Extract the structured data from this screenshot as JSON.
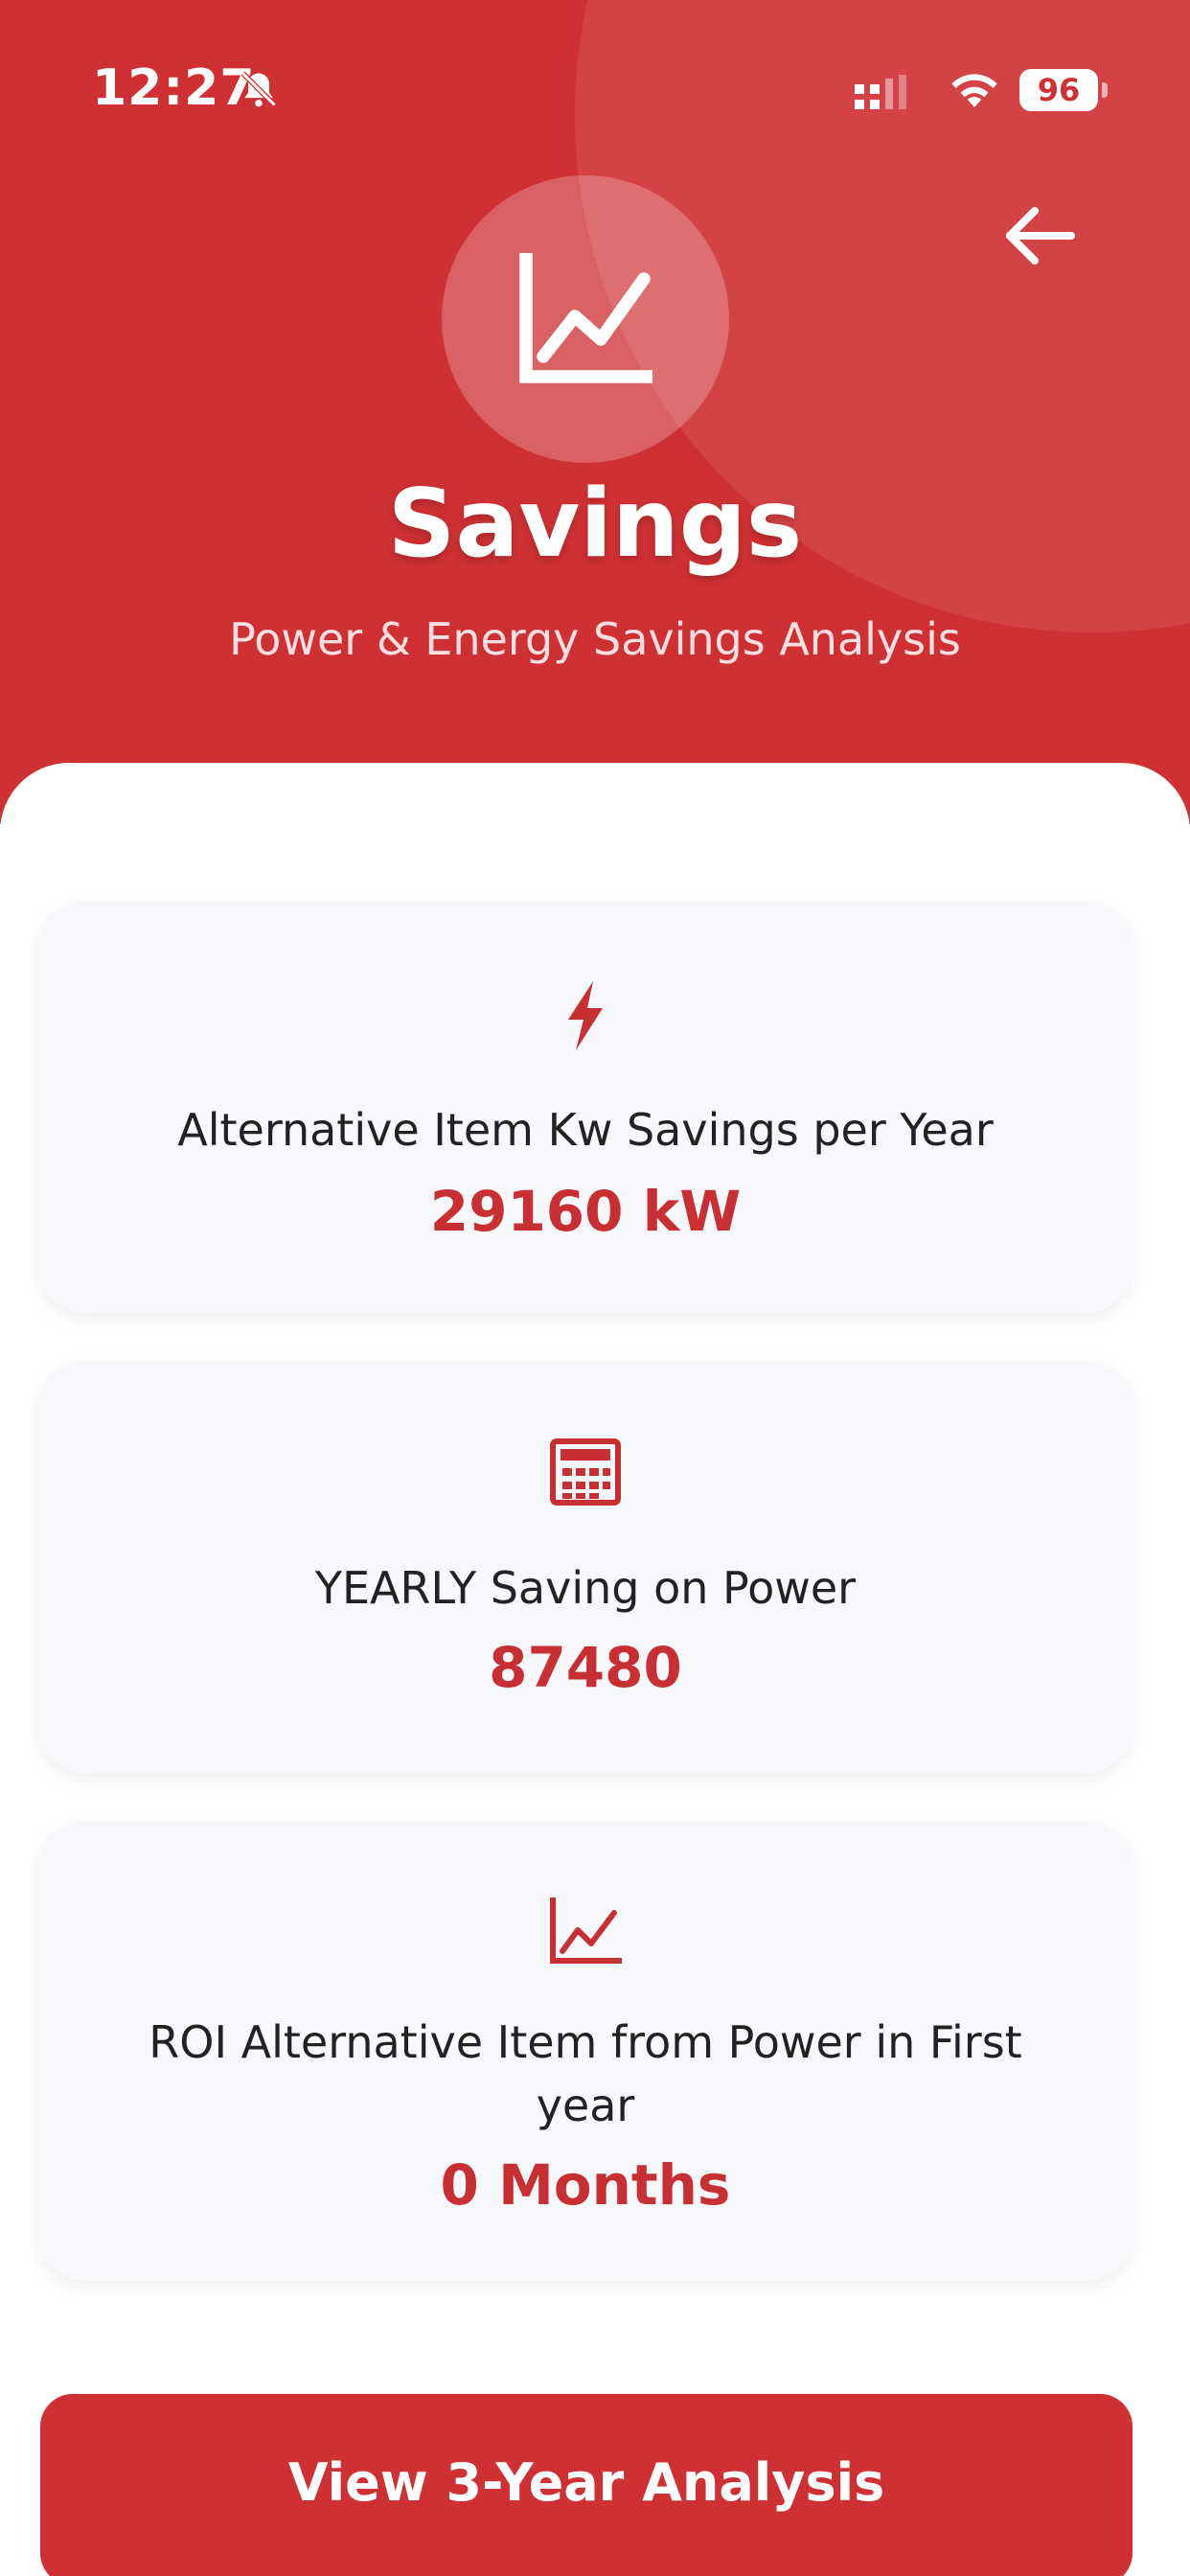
{
  "status_bar": {
    "time": "12:27",
    "battery": "96"
  },
  "header": {
    "title": "Savings",
    "subtitle": "Power & Energy Savings Analysis",
    "icons": {
      "logo": "chart-line-icon",
      "back": "arrow-left-icon"
    }
  },
  "cards": [
    {
      "icon": "lightning-bolt-icon",
      "label": "Alternative Item Kw Savings per Year",
      "value": "29160 kW"
    },
    {
      "icon": "calculator-icon",
      "label": "YEARLY Saving on Power",
      "value": "87480"
    },
    {
      "icon": "chart-line-icon",
      "label": "ROI Alternative Item from Power in First year",
      "value": "0 Months"
    }
  ],
  "cta": {
    "label": "View 3-Year Analysis"
  },
  "colors": {
    "primary_red": "#cf3033",
    "value_red": "#c72f33",
    "card_background": "#f6f8fb",
    "label_text": "#222222"
  }
}
